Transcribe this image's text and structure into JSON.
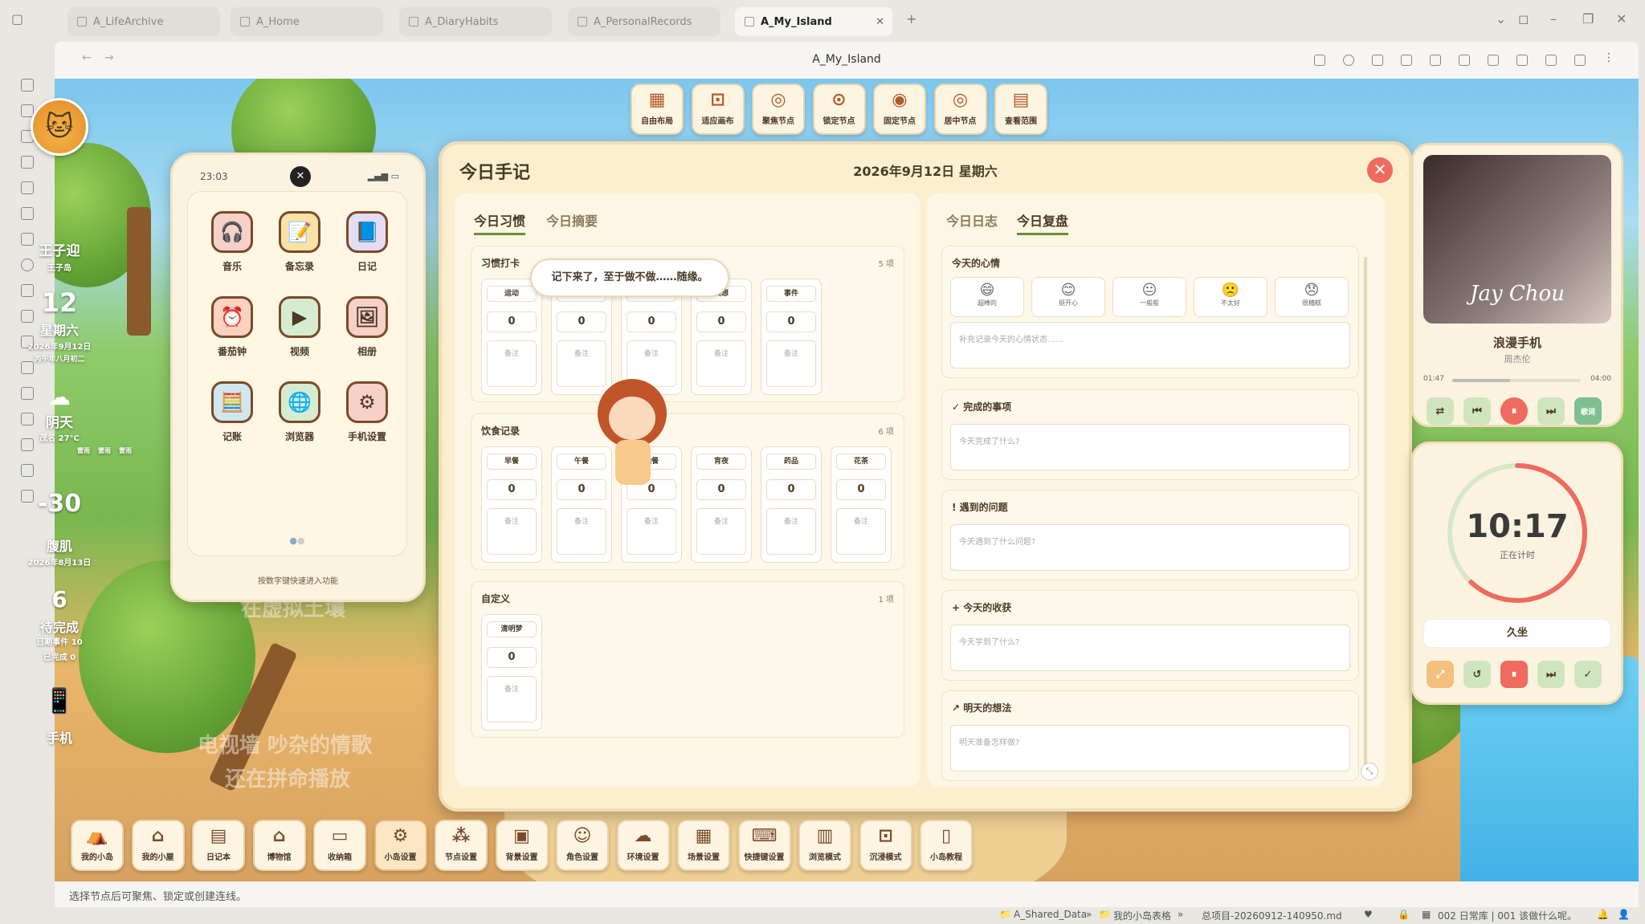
{
  "browser": {
    "tabs": [
      "A_LifeArchive",
      "A_Home",
      "A_DiaryHabits",
      "A_PersonalRecords",
      "A_My_Island"
    ],
    "active_tab": "A_My_Island",
    "page_title": "A_My_Island"
  },
  "profile": {
    "name": "王子迎",
    "subname": "王子岛",
    "day": "12",
    "weekday": "星期六",
    "date": "2026年9月12日",
    "lunar": "丙午年八月初二",
    "weather": "阴天",
    "weather_detail": "茂名 27°C",
    "weather_items": [
      "雷雨",
      "雷雨",
      "雷雨"
    ],
    "countdown": "-30",
    "countdown_label": "腹肌",
    "countdown_date": "2026年8月13日",
    "todo_count": "6",
    "todo_label": "待完成",
    "todo_items": [
      "日期事件 10",
      "已完成 0"
    ],
    "phone_label": "手机"
  },
  "phone": {
    "time": "23:03",
    "apps": [
      {
        "label": "音乐",
        "icon": "🎧"
      },
      {
        "label": "备忘录",
        "icon": "📝"
      },
      {
        "label": "日记",
        "icon": "📘"
      },
      {
        "label": "番茄钟",
        "icon": "⏰"
      },
      {
        "label": "视频",
        "icon": "▶"
      },
      {
        "label": "相册",
        "icon": "🖼"
      },
      {
        "label": "记账",
        "icon": "🧮"
      },
      {
        "label": "浏览器",
        "icon": "🌐"
      },
      {
        "label": "手机设置",
        "icon": "⚙"
      }
    ],
    "hint": "按数字键快速进入功能"
  },
  "top_tools": [
    "自由布局",
    "适应画布",
    "聚焦节点",
    "锁定节点",
    "固定节点",
    "居中节点",
    "查看范围"
  ],
  "diary": {
    "title": "今日手记",
    "date": "2026年9月12日 星期六",
    "left_tabs": [
      "今日习惯",
      "今日摘要"
    ],
    "right_tabs": [
      "今日日志",
      "今日复盘"
    ],
    "habit": {
      "title": "习惯打卡",
      "count": "5 项",
      "items": [
        {
          "label": "运动",
          "value": "0"
        },
        {
          "label": "手艺",
          "value": "0"
        },
        {
          "label": "阅读",
          "value": "0"
        },
        {
          "label": "冥想",
          "value": "0"
        },
        {
          "label": "事件",
          "value": "0"
        }
      ]
    },
    "food": {
      "title": "饮食记录",
      "count": "6 项",
      "items": [
        {
          "label": "早餐",
          "value": "0"
        },
        {
          "label": "午餐",
          "value": "0"
        },
        {
          "label": "晚餐",
          "value": "0"
        },
        {
          "label": "宵夜",
          "value": "0"
        },
        {
          "label": "药品",
          "value": "0"
        },
        {
          "label": "花茶",
          "value": "0"
        }
      ]
    },
    "custom": {
      "title": "自定义",
      "count": "1 项",
      "items": [
        {
          "label": "清明梦",
          "value": "0"
        }
      ]
    },
    "note_placeholder": "备注",
    "mood": {
      "title": "今天的心情",
      "options": [
        "超棒的",
        "挺开心",
        "一般般",
        "不太好",
        "很糟糕"
      ],
      "placeholder": "补充记录今天的心情状态……"
    },
    "review": [
      {
        "title": "完成的事项",
        "placeholder": "今天完成了什么?"
      },
      {
        "title": "遇到的问题",
        "placeholder": "今天遇到了什么问题?"
      },
      {
        "title": "今天的收获",
        "placeholder": "今天学到了什么?"
      },
      {
        "title": "明天的想法",
        "placeholder": "明天准备怎样做?"
      }
    ]
  },
  "bubble": "记下来了，至于做不做……随缘。",
  "music": {
    "song": "浪漫手机",
    "artist": "周杰伦",
    "current": "01:47",
    "total": "04:00",
    "progress": 0.45,
    "lyrics": "歌词",
    "album_text": "Jay Chou"
  },
  "timer": {
    "time": "10:17",
    "status": "正在计时",
    "task": "久坐",
    "progress": 0.62
  },
  "dock": [
    "我的小岛",
    "我的小屋",
    "日记本",
    "博物馆",
    "收纳箱",
    "小岛设置",
    "节点设置",
    "背景设置",
    "角色设置",
    "环境设置",
    "场景设置",
    "快捷键设置",
    "浏览模式",
    "沉浸模式",
    "小岛教程"
  ],
  "background_text": [
    "在虚拟土壤",
    "电视墙 吵杂的情歌",
    "还在拼命播放"
  ],
  "status": {
    "hint": "选择节点后可聚焦、锁定或创建连线。",
    "path": [
      "A_Shared_Data",
      "我的小岛表格",
      "总项目-20260912-140950.md"
    ],
    "db": "002 日常库 | 001 该做什么呢。"
  },
  "colors": {
    "accent_green": "#6b8f3b",
    "close_red": "#ee6b5e",
    "timer_ring": "#ee6b5e"
  }
}
